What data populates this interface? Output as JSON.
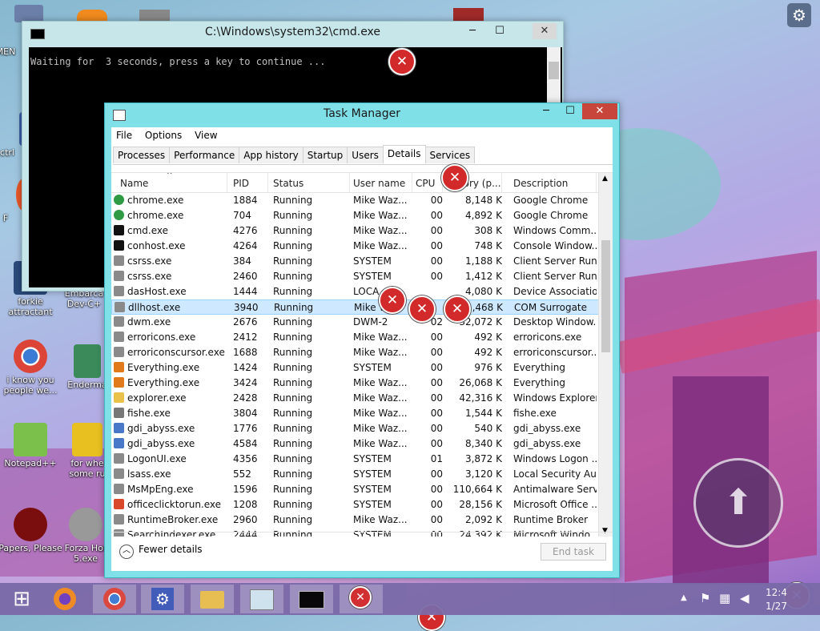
{
  "desktop": {
    "icons": [
      {
        "label": "MEN"
      },
      {
        "label": "ctrl"
      },
      {
        "label": "F"
      },
      {
        "label": "forkie attractant"
      },
      {
        "label": "Embarca Dev-C+"
      },
      {
        "label": "i know you people we..."
      },
      {
        "label": "Enderma"
      },
      {
        "label": "Notepad++"
      },
      {
        "label": "for whe some ru"
      },
      {
        "label": "Papers, Please"
      },
      {
        "label": "Forza Hor 5.exe"
      }
    ]
  },
  "cmd": {
    "title": "C:\\Windows\\system32\\cmd.exe",
    "output": "Waiting for  3 seconds, press a key to continue ...",
    "min": "─",
    "max": "☐",
    "close": "✕"
  },
  "taskmanager": {
    "title": "Task Manager",
    "min": "─",
    "max": "☐",
    "close": "✕",
    "menu": [
      "File",
      "Options",
      "View"
    ],
    "tabs": [
      "Processes",
      "Performance",
      "App history",
      "Startup",
      "Users",
      "Details",
      "Services"
    ],
    "active_tab": "Details",
    "columns": {
      "name": "Name",
      "pid": "PID",
      "status": "Status",
      "user": "User name",
      "cpu": "CPU",
      "mem": "nory (p...",
      "desc": "Description"
    },
    "rows": [
      {
        "name": "chrome.exe",
        "pid": "1884",
        "status": "Running",
        "user": "Mike Waz...",
        "cpu": "00",
        "mem": "8,148 K",
        "desc": "Google Chrome",
        "icon": "chrome",
        "color": "#2f9a44"
      },
      {
        "name": "chrome.exe",
        "pid": "704",
        "status": "Running",
        "user": "Mike Waz...",
        "cpu": "00",
        "mem": "4,892 K",
        "desc": "Google Chrome",
        "icon": "chrome",
        "color": "#2f9a44"
      },
      {
        "name": "cmd.exe",
        "pid": "4276",
        "status": "Running",
        "user": "Mike Waz...",
        "cpu": "00",
        "mem": "308 K",
        "desc": "Windows Comm...",
        "icon": "console",
        "color": "#111111"
      },
      {
        "name": "conhost.exe",
        "pid": "4264",
        "status": "Running",
        "user": "Mike Waz...",
        "cpu": "00",
        "mem": "748 K",
        "desc": "Console Window...",
        "icon": "console",
        "color": "#111111"
      },
      {
        "name": "csrss.exe",
        "pid": "384",
        "status": "Running",
        "user": "SYSTEM",
        "cpu": "00",
        "mem": "1,188 K",
        "desc": "Client Server Run...",
        "icon": "app",
        "color": "#8a8a8a"
      },
      {
        "name": "csrss.exe",
        "pid": "2460",
        "status": "Running",
        "user": "SYSTEM",
        "cpu": "00",
        "mem": "1,412 K",
        "desc": "Client Server Run...",
        "icon": "app",
        "color": "#8a8a8a"
      },
      {
        "name": "dasHost.exe",
        "pid": "1444",
        "status": "Running",
        "user": "LOCA",
        "cpu": "",
        "mem": "4,080 K",
        "desc": "Device Associatio...",
        "icon": "app",
        "color": "#8a8a8a"
      },
      {
        "name": "dllhost.exe",
        "pid": "3940",
        "status": "Running",
        "user": "Mike W",
        "cpu": "",
        "mem": "1,468 K",
        "desc": "COM Surrogate",
        "icon": "app",
        "color": "#8a8a8a",
        "selected": true
      },
      {
        "name": "dwm.exe",
        "pid": "2676",
        "status": "Running",
        "user": "DWM-2",
        "cpu": "02",
        "mem": "32,072 K",
        "desc": "Desktop Window...",
        "icon": "app",
        "color": "#8a8a8a"
      },
      {
        "name": "erroricons.exe",
        "pid": "2412",
        "status": "Running",
        "user": "Mike Waz...",
        "cpu": "00",
        "mem": "492 K",
        "desc": "erroricons.exe",
        "icon": "app",
        "color": "#8a8a8a"
      },
      {
        "name": "erroriconscursor.exe",
        "pid": "1688",
        "status": "Running",
        "user": "Mike Waz...",
        "cpu": "00",
        "mem": "492 K",
        "desc": "erroriconscursor...",
        "icon": "app",
        "color": "#8a8a8a"
      },
      {
        "name": "Everything.exe",
        "pid": "1424",
        "status": "Running",
        "user": "SYSTEM",
        "cpu": "00",
        "mem": "976 K",
        "desc": "Everything",
        "icon": "search",
        "color": "#e07a1a"
      },
      {
        "name": "Everything.exe",
        "pid": "3424",
        "status": "Running",
        "user": "Mike Waz...",
        "cpu": "00",
        "mem": "26,068 K",
        "desc": "Everything",
        "icon": "search",
        "color": "#e07a1a"
      },
      {
        "name": "explorer.exe",
        "pid": "2428",
        "status": "Running",
        "user": "Mike Waz...",
        "cpu": "00",
        "mem": "42,316 K",
        "desc": "Windows Explorer",
        "icon": "folder",
        "color": "#e8c04a"
      },
      {
        "name": "fishe.exe",
        "pid": "3804",
        "status": "Running",
        "user": "Mike Waz...",
        "cpu": "00",
        "mem": "1,544 K",
        "desc": "fishe.exe",
        "icon": "fish",
        "color": "#777777"
      },
      {
        "name": "gdi_abyss.exe",
        "pid": "1776",
        "status": "Running",
        "user": "Mike Waz...",
        "cpu": "00",
        "mem": "540 K",
        "desc": "gdi_abyss.exe",
        "icon": "shield",
        "color": "#4a78c8"
      },
      {
        "name": "gdi_abyss.exe",
        "pid": "4584",
        "status": "Running",
        "user": "Mike Waz...",
        "cpu": "00",
        "mem": "8,340 K",
        "desc": "gdi_abyss.exe",
        "icon": "shield",
        "color": "#4a78c8"
      },
      {
        "name": "LogonUI.exe",
        "pid": "4356",
        "status": "Running",
        "user": "SYSTEM",
        "cpu": "01",
        "mem": "3,872 K",
        "desc": "Windows Logon ...",
        "icon": "app",
        "color": "#8a8a8a"
      },
      {
        "name": "lsass.exe",
        "pid": "552",
        "status": "Running",
        "user": "SYSTEM",
        "cpu": "00",
        "mem": "3,120 K",
        "desc": "Local Security Au...",
        "icon": "app",
        "color": "#8a8a8a"
      },
      {
        "name": "MsMpEng.exe",
        "pid": "1596",
        "status": "Running",
        "user": "SYSTEM",
        "cpu": "00",
        "mem": "110,664 K",
        "desc": "Antimalware Serv...",
        "icon": "app",
        "color": "#8a8a8a"
      },
      {
        "name": "officeclicktorun.exe",
        "pid": "1208",
        "status": "Running",
        "user": "SYSTEM",
        "cpu": "00",
        "mem": "28,156 K",
        "desc": "Microsoft Office ...",
        "icon": "office",
        "color": "#d9482b"
      },
      {
        "name": "RuntimeBroker.exe",
        "pid": "2960",
        "status": "Running",
        "user": "Mike Waz...",
        "cpu": "00",
        "mem": "2,092 K",
        "desc": "Runtime Broker",
        "icon": "app",
        "color": "#8a8a8a"
      },
      {
        "name": "SearchIndexer.exe",
        "pid": "2444",
        "status": "Running",
        "user": "SYSTEM",
        "cpu": "00",
        "mem": "24,392 K",
        "desc": "Microsoft Windo...",
        "icon": "search",
        "color": "#8a8a8a"
      }
    ],
    "footer": {
      "fewer": "Fewer details",
      "end_task": "End task"
    }
  },
  "error_glyph": "✕",
  "taskbar": {
    "start": "⊞",
    "apps": [
      "firefox",
      "chrome",
      "settings",
      "explorer",
      "task-manager",
      "cmd",
      "error"
    ],
    "clock_time": "12:4",
    "clock_date": "1/27",
    "accent": "#7fe0e8"
  }
}
